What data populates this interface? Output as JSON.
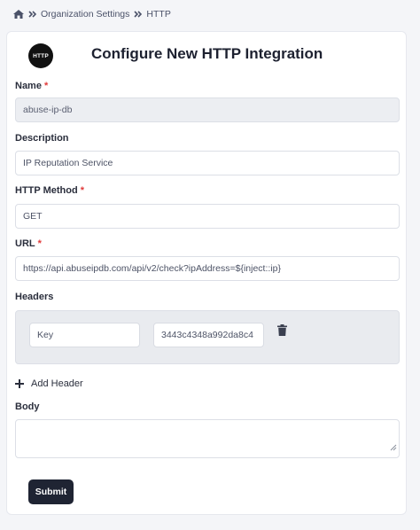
{
  "breadcrumb": {
    "items": [
      "Organization Settings",
      "HTTP"
    ]
  },
  "integration": {
    "logo_text": "HTTP",
    "title": "Configure New HTTP Integration"
  },
  "form": {
    "name": {
      "label": "Name",
      "required": "*",
      "value": "abuse-ip-db"
    },
    "description": {
      "label": "Description",
      "value": "IP Reputation Service"
    },
    "method": {
      "label": "HTTP Method",
      "required": "*",
      "value": "GET"
    },
    "url": {
      "label": "URL",
      "required": "*",
      "value": "https://api.abuseipdb.com/api/v2/check?ipAddress=${inject::ip}"
    },
    "headers": {
      "label": "Headers",
      "rows": [
        {
          "key": "Key",
          "value": "3443c4348a992da8c4"
        }
      ],
      "add_label": "Add Header"
    },
    "body": {
      "label": "Body",
      "value": ""
    },
    "submit_label": "Submit"
  },
  "colors": {
    "accent": "#1f2433",
    "required": "#e03a3a",
    "page_background": "#f4f5f8"
  },
  "icons": [
    "home-icon",
    "double-chevron-right-icon",
    "trash-icon",
    "plus-icon",
    "resize-grip-icon"
  ]
}
